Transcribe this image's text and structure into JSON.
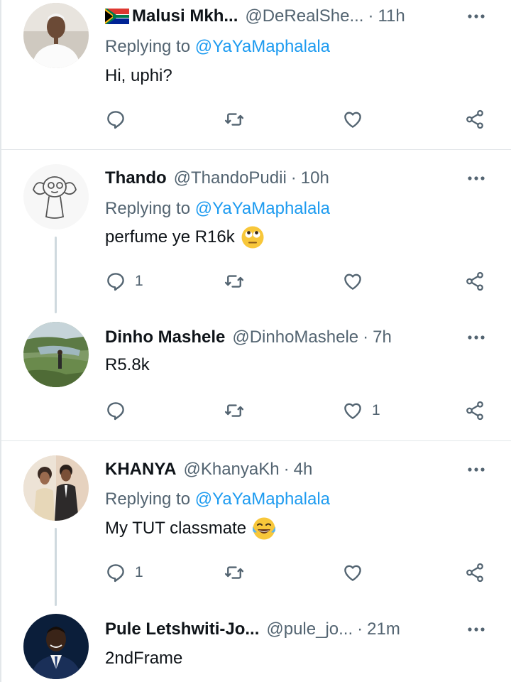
{
  "tweets": [
    {
      "name": "Malusi Mkh...",
      "handle": "@DeRealShe...",
      "time": "11h",
      "flag": "south-africa-flag-icon",
      "reply_label": "Replying to",
      "reply_to": "@YaYaMaphalala",
      "text": "Hi, uphi?",
      "reply_count": "",
      "retweet_count": "",
      "like_count": ""
    },
    {
      "name": "Thando",
      "handle": "@ThandoPudii",
      "time": "10h",
      "reply_label": "Replying to",
      "reply_to": "@YaYaMaphalala",
      "text": "perfume ye R16k",
      "emoji": "face-with-rolling-eyes-icon",
      "reply_count": "1",
      "retweet_count": "",
      "like_count": ""
    },
    {
      "name": "Dinho Mashele",
      "handle": "@DinhoMashele",
      "time": "7h",
      "text": "R5.8k",
      "reply_count": "",
      "retweet_count": "",
      "like_count": "1"
    },
    {
      "name": "KHANYA",
      "handle": "@KhanyaKh",
      "time": "4h",
      "reply_label": "Replying to",
      "reply_to": "@YaYaMaphalala",
      "text": "My TUT classmate",
      "emoji": "face-with-tears-of-joy-icon",
      "reply_count": "1",
      "retweet_count": "",
      "like_count": ""
    },
    {
      "name": "Pule Letshwiti-Jo...",
      "handle": "@pule_jo...",
      "time": "21m",
      "text": "2ndFrame"
    }
  ],
  "separator": "·",
  "colors": {
    "text": "#0f1419",
    "secondary": "#536471",
    "accent": "#1d9bf0",
    "divider": "#e3e7ea",
    "thread_line": "#cfd9de"
  }
}
